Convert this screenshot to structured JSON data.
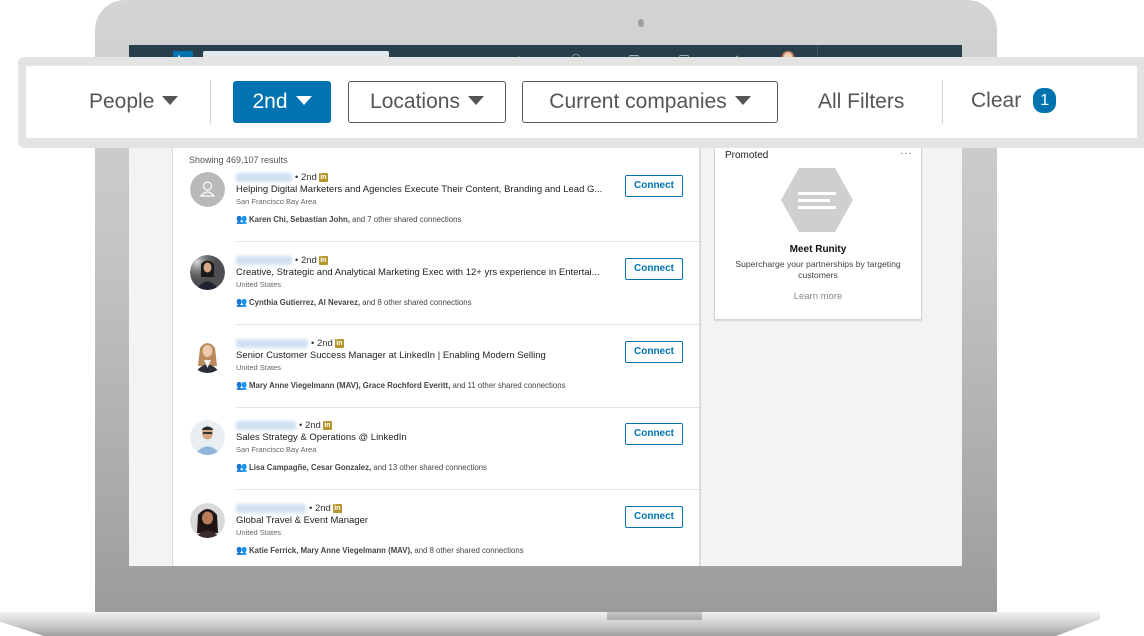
{
  "filters": {
    "type_label": "People",
    "connection_label": "2nd",
    "locations_label": "Locations",
    "companies_label": "Current companies",
    "all_filters_label": "All Filters",
    "clear_label": "Clear",
    "clear_count": "1"
  },
  "nav": {
    "logo": "in"
  },
  "results": {
    "showing": "Showing 469,107 results",
    "connect_label": "Connect",
    "items": [
      {
        "degree": "• 2nd",
        "headline": "Helping Digital Marketers and Agencies Execute Their Content, Branding and Lead G...",
        "location": "San Francisco Bay Area",
        "shared_names": "Karen Chi, Sebastian John,",
        "shared_rest": "and 7 other shared connections",
        "avatar": "placeholder"
      },
      {
        "degree": "• 2nd",
        "headline": "Creative, Strategic and Analytical Marketing Exec with 12+ yrs experience in Entertai...",
        "location": "United States",
        "shared_names": "Cynthia Gutierrez, Al Nevarez,",
        "shared_rest": "and 8 other shared connections",
        "avatar": "photo"
      },
      {
        "degree": "• 2nd",
        "headline": "Senior Customer Success Manager at LinkedIn | Enabling Modern Selling",
        "location": "United States",
        "shared_names": "Mary Anne Viegelmann (MAV), Grace Rochford Everitt,",
        "shared_rest": "and 11 other shared connections",
        "avatar": "photo"
      },
      {
        "degree": "• 2nd",
        "headline": "Sales Strategy & Operations @ LinkedIn",
        "location": "San Francisco Bay Area",
        "shared_names": "Lisa Campagñe, Cesar Gonzalez,",
        "shared_rest": "and 13 other shared connections",
        "avatar": "photo"
      },
      {
        "degree": "• 2nd",
        "headline": "Global Travel & Event Manager",
        "location": "United States",
        "shared_names": "Katie Ferrick, Mary Anne Viegelmann (MAV),",
        "shared_rest": "and 8 other shared connections",
        "avatar": "photo"
      }
    ]
  },
  "promo": {
    "label": "Promoted",
    "more": "···",
    "name": "Meet Runity",
    "description": "Supercharge your partnerships by targeting customers",
    "cta": "Learn more"
  },
  "colors": {
    "brand": "#0073b1",
    "nav_bg": "#283e4a",
    "premium_gold": "#b5972d"
  }
}
